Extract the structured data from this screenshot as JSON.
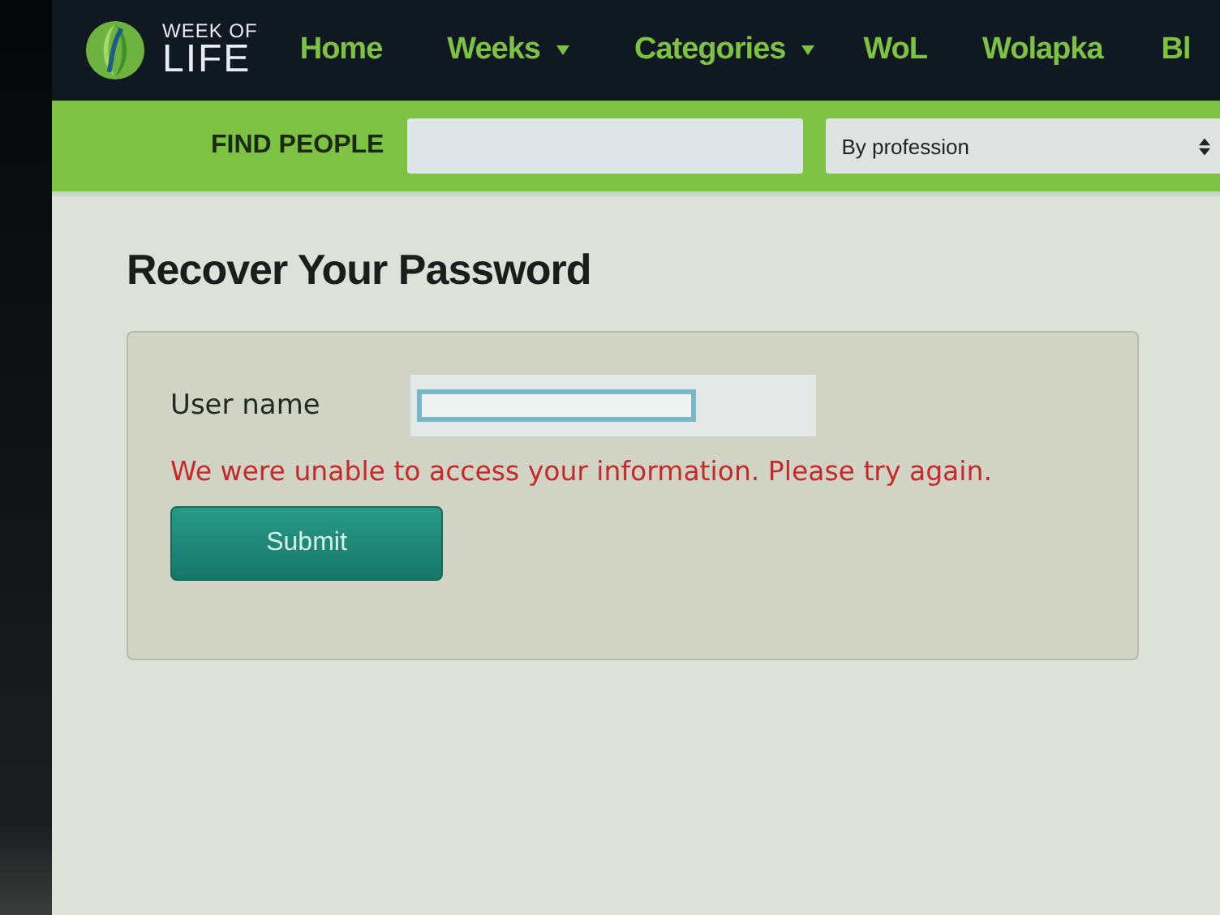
{
  "logo": {
    "line_1": "WEEK OF",
    "line_2": "LIFE"
  },
  "nav": [
    {
      "label": "Home",
      "dropdown": false
    },
    {
      "label": "Weeks",
      "dropdown": true
    },
    {
      "label": "Categories",
      "dropdown": true
    },
    {
      "label": "WoL",
      "dropdown": false
    },
    {
      "label": "Wolapka",
      "dropdown": false
    },
    {
      "label": "Bl",
      "dropdown": false
    }
  ],
  "find_people": {
    "label": "FIND PEOPLE",
    "select_value": "By profession"
  },
  "heading": "Recover Your Password",
  "form": {
    "field_label": "User name",
    "focused": true,
    "error": "We were unable to access your information. Please try again.",
    "submit": "Submit"
  }
}
